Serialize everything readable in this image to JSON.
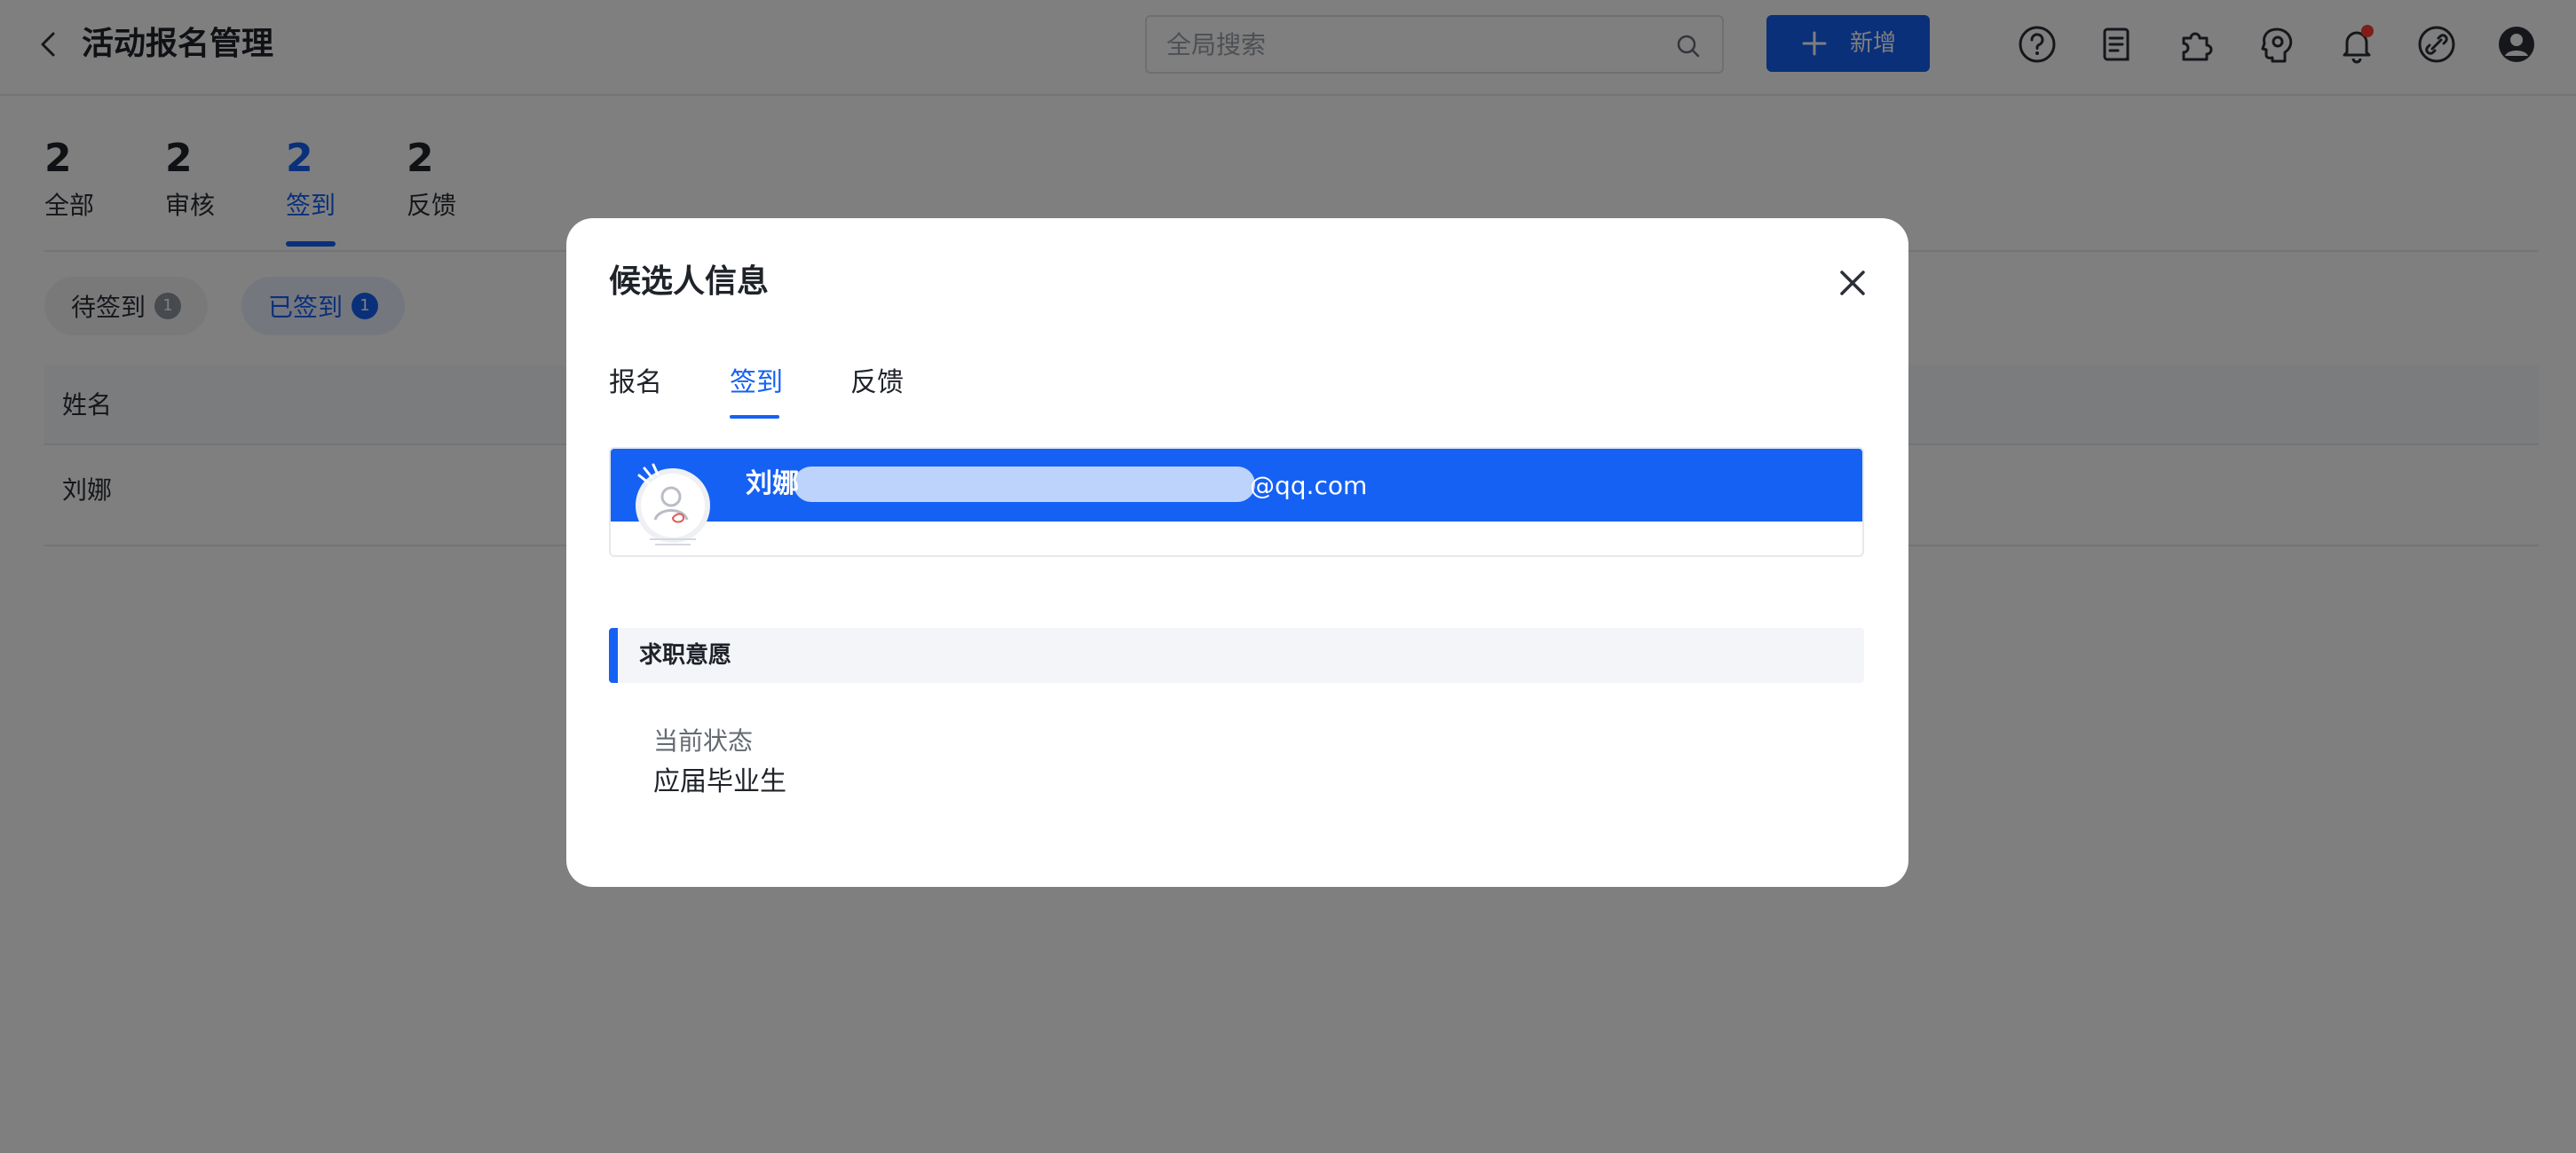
{
  "header": {
    "title": "活动报名管理",
    "search_placeholder": "全局搜索",
    "add_label": "新增"
  },
  "stats": [
    {
      "count": "2",
      "label": "全部"
    },
    {
      "count": "2",
      "label": "审核"
    },
    {
      "count": "2",
      "label": "签到"
    },
    {
      "count": "2",
      "label": "反馈"
    }
  ],
  "filters": [
    {
      "label": "待签到",
      "count": "1"
    },
    {
      "label": "已签到",
      "count": "1"
    }
  ],
  "table": {
    "columns": [
      "姓名"
    ],
    "rows": [
      [
        "刘娜"
      ]
    ]
  },
  "modal": {
    "title": "候选人信息",
    "tabs": [
      "报名",
      "签到",
      "反馈"
    ],
    "active_tab": "签到",
    "candidate": {
      "name": "刘娜",
      "email_visible": "@qq.com"
    },
    "section_title": "求职意愿",
    "field_label": "当前状态",
    "field_value": "应届毕业生"
  },
  "colors": {
    "accent": "#1561f4",
    "notification_dot": "#ff3b30",
    "overlay": "rgba(0,0,0,0.5)"
  }
}
